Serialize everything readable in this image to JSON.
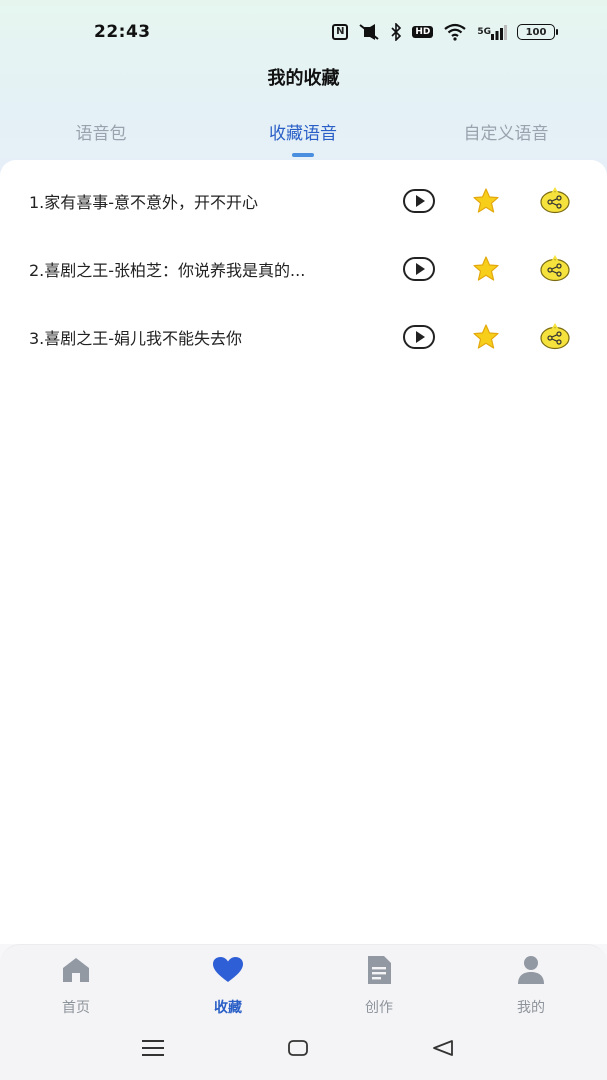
{
  "status_bar": {
    "time": "22:43",
    "icons": [
      "nfc-icon",
      "mute-icon",
      "bluetooth-icon",
      "hd-icon",
      "wifi-icon",
      "signal-5g-icon",
      "battery-icon"
    ],
    "hd_label": "HD",
    "network_label": "5G",
    "battery_level": "100"
  },
  "header": {
    "title": "我的收藏"
  },
  "tabs": [
    {
      "label": "语音包",
      "active": false
    },
    {
      "label": "收藏语音",
      "active": true
    },
    {
      "label": "自定义语音",
      "active": false
    }
  ],
  "favorites": [
    {
      "title": "1.家有喜事-意不意外，开不开心"
    },
    {
      "title": "2.喜剧之王-张柏芝：你说养我是真的..."
    },
    {
      "title": "3.喜剧之王-娟儿我不能失去你"
    }
  ],
  "bottom_nav": [
    {
      "label": "首页",
      "icon": "home-icon",
      "active": false
    },
    {
      "label": "收藏",
      "icon": "heart-icon",
      "active": true
    },
    {
      "label": "创作",
      "icon": "document-icon",
      "active": false
    },
    {
      "label": "我的",
      "icon": "person-icon",
      "active": false
    }
  ],
  "system_nav": [
    "menu-icon",
    "home-square-icon",
    "back-triangle-icon"
  ],
  "colors": {
    "accent": "#2a5fc7",
    "tab_indicator": "#4a8fdf",
    "inactive_text": "#9aa3ad",
    "star": "#f7cf1b",
    "share_bubble": "#f6e23c"
  }
}
